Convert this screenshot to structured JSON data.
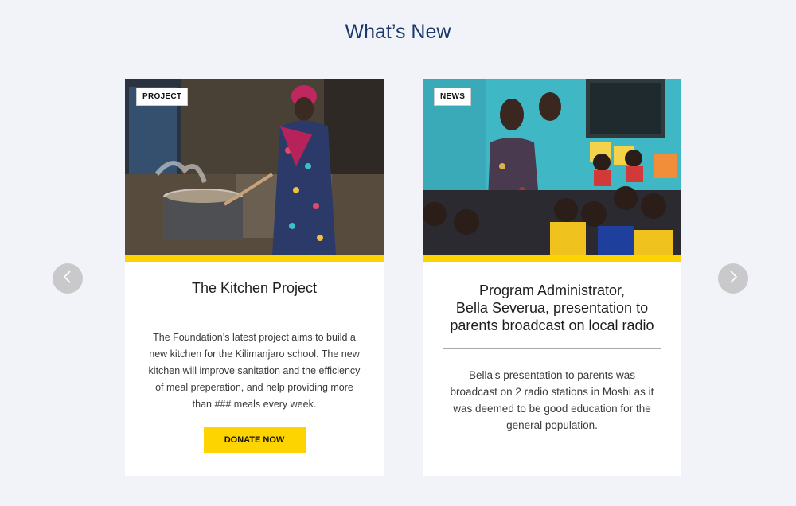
{
  "section": {
    "title": "What’s New"
  },
  "nav": {
    "prev_icon": "chevron-left-icon",
    "next_icon": "chevron-right-icon"
  },
  "colors": {
    "accent": "#fdd400",
    "title": "#1b3a6b",
    "background": "#f2f3f8"
  },
  "cards": [
    {
      "tag": "PROJECT",
      "title": "The Kitchen Project",
      "body": "The Foundation’s latest project aims to build a new kitchen for the Kilimanjaro school. The new kitchen will improve sanitation and the efficiency of meal preperation, and help providing more than ### meals every week.",
      "button_label": "DONATE NOW"
    },
    {
      "tag": "NEWS",
      "title_lines": [
        "Program Administrator,",
        "Bella Severua, presentation to",
        "parents broadcast on local radio"
      ],
      "body": "Bella’s presentation to parents was broadcast on 2 radio stations in Moshi as it was deemed to be good education for the general population."
    }
  ]
}
